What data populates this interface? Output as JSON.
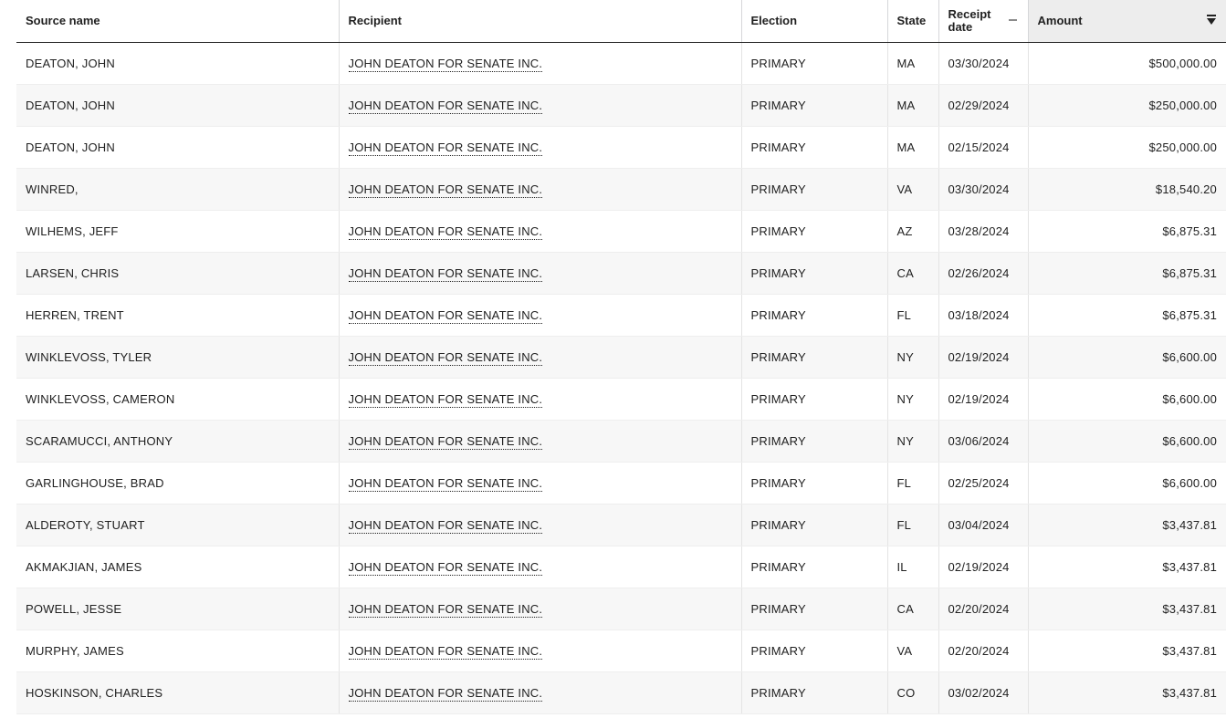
{
  "table": {
    "headers": {
      "source_name": "Source name",
      "recipient": "Recipient",
      "election": "Election",
      "state": "State",
      "receipt_date_line1": "Receipt",
      "receipt_date_line2": "date",
      "amount": "Amount"
    },
    "sort": {
      "column": "amount",
      "direction": "descending"
    },
    "colors": {
      "sorted_header_bg": "#ededed",
      "stripe_bg": "#f7f7f7"
    },
    "rows": [
      {
        "source": "DEATON, JOHN",
        "recipient": "JOHN DEATON FOR SENATE INC.",
        "election": "PRIMARY",
        "state": "MA",
        "date": "03/30/2024",
        "amount": "$500,000.00"
      },
      {
        "source": "DEATON, JOHN",
        "recipient": "JOHN DEATON FOR SENATE INC.",
        "election": "PRIMARY",
        "state": "MA",
        "date": "02/29/2024",
        "amount": "$250,000.00"
      },
      {
        "source": "DEATON, JOHN",
        "recipient": "JOHN DEATON FOR SENATE INC.",
        "election": "PRIMARY",
        "state": "MA",
        "date": "02/15/2024",
        "amount": "$250,000.00"
      },
      {
        "source": "WINRED,",
        "recipient": "JOHN DEATON FOR SENATE INC.",
        "election": "PRIMARY",
        "state": "VA",
        "date": "03/30/2024",
        "amount": "$18,540.20"
      },
      {
        "source": "WILHEMS, JEFF",
        "recipient": "JOHN DEATON FOR SENATE INC.",
        "election": "PRIMARY",
        "state": "AZ",
        "date": "03/28/2024",
        "amount": "$6,875.31"
      },
      {
        "source": "LARSEN, CHRIS",
        "recipient": "JOHN DEATON FOR SENATE INC.",
        "election": "PRIMARY",
        "state": "CA",
        "date": "02/26/2024",
        "amount": "$6,875.31"
      },
      {
        "source": "HERREN, TRENT",
        "recipient": "JOHN DEATON FOR SENATE INC.",
        "election": "PRIMARY",
        "state": "FL",
        "date": "03/18/2024",
        "amount": "$6,875.31"
      },
      {
        "source": "WINKLEVOSS, TYLER",
        "recipient": "JOHN DEATON FOR SENATE INC.",
        "election": "PRIMARY",
        "state": "NY",
        "date": "02/19/2024",
        "amount": "$6,600.00"
      },
      {
        "source": "WINKLEVOSS, CAMERON",
        "recipient": "JOHN DEATON FOR SENATE INC.",
        "election": "PRIMARY",
        "state": "NY",
        "date": "02/19/2024",
        "amount": "$6,600.00"
      },
      {
        "source": "SCARAMUCCI, ANTHONY",
        "recipient": "JOHN DEATON FOR SENATE INC.",
        "election": "PRIMARY",
        "state": "NY",
        "date": "03/06/2024",
        "amount": "$6,600.00"
      },
      {
        "source": "GARLINGHOUSE, BRAD",
        "recipient": "JOHN DEATON FOR SENATE INC.",
        "election": "PRIMARY",
        "state": "FL",
        "date": "02/25/2024",
        "amount": "$6,600.00"
      },
      {
        "source": "ALDEROTY, STUART",
        "recipient": "JOHN DEATON FOR SENATE INC.",
        "election": "PRIMARY",
        "state": "FL",
        "date": "03/04/2024",
        "amount": "$3,437.81"
      },
      {
        "source": "AKMAKJIAN, JAMES",
        "recipient": "JOHN DEATON FOR SENATE INC.",
        "election": "PRIMARY",
        "state": "IL",
        "date": "02/19/2024",
        "amount": "$3,437.81"
      },
      {
        "source": "POWELL, JESSE",
        "recipient": "JOHN DEATON FOR SENATE INC.",
        "election": "PRIMARY",
        "state": "CA",
        "date": "02/20/2024",
        "amount": "$3,437.81"
      },
      {
        "source": "MURPHY, JAMES",
        "recipient": "JOHN DEATON FOR SENATE INC.",
        "election": "PRIMARY",
        "state": "VA",
        "date": "02/20/2024",
        "amount": "$3,437.81"
      },
      {
        "source": "HOSKINSON, CHARLES",
        "recipient": "JOHN DEATON FOR SENATE INC.",
        "election": "PRIMARY",
        "state": "CO",
        "date": "03/02/2024",
        "amount": "$3,437.81"
      }
    ]
  }
}
